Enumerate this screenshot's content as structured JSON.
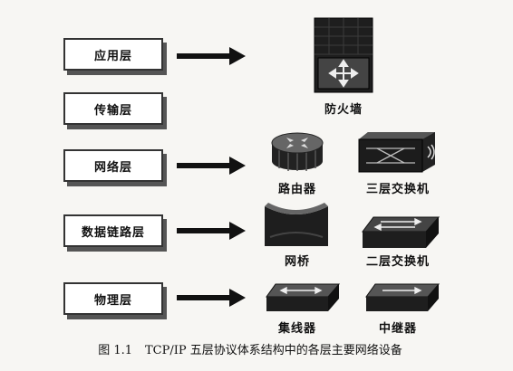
{
  "layers": [
    {
      "id": "application",
      "label": "应用层",
      "has_arrow": true
    },
    {
      "id": "transport",
      "label": "传输层",
      "has_arrow": false
    },
    {
      "id": "network",
      "label": "网络层",
      "has_arrow": true
    },
    {
      "id": "datalink",
      "label": "数据链路层",
      "has_arrow": true
    },
    {
      "id": "physical",
      "label": "物理层",
      "has_arrow": true
    }
  ],
  "devices": {
    "firewall": "防火墙",
    "router": "路由器",
    "l3_switch": "三层交换机",
    "bridge": "网桥",
    "l2_switch": "二层交换机",
    "hub": "集线器",
    "repeater": "中继器"
  },
  "caption": {
    "number": "图 1.1",
    "text": "TCP/IP 五层协议体系结构中的各层主要网络设备"
  },
  "colors": {
    "box_border": "#333333",
    "arrow": "#111111",
    "device_dark": "#2a2a2a"
  }
}
